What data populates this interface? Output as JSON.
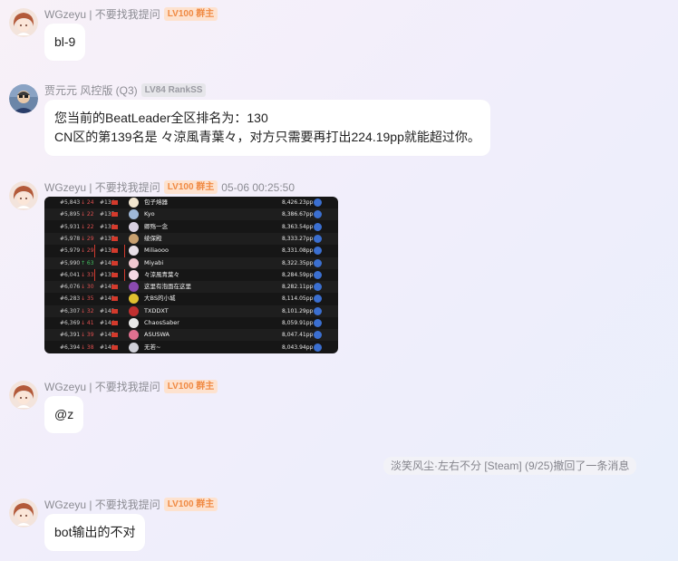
{
  "messages": [
    {
      "sender": "WGzeyu | 不要找我提问",
      "badge": "LV100 群主",
      "text": "bl-9"
    },
    {
      "sender": "贾元元 风控版 (Q3)",
      "badge": "LV84 RankSS",
      "line1": "您当前的BeatLeader全区排名为：130",
      "line2": "CN区的第139名是 々涼風青葉々，对方只需要再打出224.19pp就能超过你。"
    },
    {
      "sender": "WGzeyu | 不要找我提问",
      "badge": "LV100 群主",
      "time": "05-06 00:25:50",
      "leaderboard": [
        {
          "global": "#5,843",
          "delta": "↓ 24",
          "dir": "down",
          "country": "#134",
          "name": "包子熔器",
          "pp": "8,426.23pp",
          "color": "#f2e6d0"
        },
        {
          "global": "#5,895",
          "delta": "↓ 22",
          "dir": "down",
          "country": "#135",
          "name": "Kyo",
          "pp": "8,386.67pp",
          "color": "#9fb8d8"
        },
        {
          "global": "#5,931",
          "delta": "↓ 22",
          "dir": "down",
          "country": "#136",
          "name": "卿殇一念",
          "pp": "8,363.54pp",
          "color": "#d8d0e0"
        },
        {
          "global": "#5,978",
          "delta": "↓ 29",
          "dir": "down",
          "country": "#137",
          "name": "绫保殿",
          "pp": "8,333.27pp",
          "color": "#c8a070"
        },
        {
          "global": "#5,979",
          "delta": "↓ 29",
          "dir": "down",
          "country": "#138",
          "name": "Miliaooo",
          "pp": "8,331.08pp",
          "color": "#e8e0e8"
        },
        {
          "global": "#5,990",
          "delta": "↑ 63",
          "dir": "up",
          "country": "#140",
          "name": "Miyabi",
          "pp": "8,322.35pp",
          "color": "#f0c8d0"
        },
        {
          "global": "#6,041",
          "delta": "↓ 33",
          "dir": "down",
          "country": "#139",
          "name": "々涼風青葉々",
          "pp": "8,284.59pp",
          "color": "#f4d8e4"
        },
        {
          "global": "#6,076",
          "delta": "↓ 30",
          "dir": "down",
          "country": "#141",
          "name": "这里有泡面在这里",
          "pp": "8,282.11pp",
          "color": "#8a4ab0"
        },
        {
          "global": "#6,283",
          "delta": "↓ 35",
          "dir": "down",
          "country": "#142",
          "name": "大BS的小城",
          "pp": "8,114.05pp",
          "color": "#e0c030"
        },
        {
          "global": "#6,307",
          "delta": "↓ 32",
          "dir": "down",
          "country": "#143",
          "name": "TXDDXT",
          "pp": "8,101.29pp",
          "color": "#c03030"
        },
        {
          "global": "#6,369",
          "delta": "↓ 41",
          "dir": "down",
          "country": "#144",
          "name": "ChaosSaber",
          "pp": "8,059.91pp",
          "color": "#e8e8e8"
        },
        {
          "global": "#6,391",
          "delta": "↓ 39",
          "dir": "down",
          "country": "#145",
          "name": "ASUSWA",
          "pp": "8,047.41pp",
          "color": "#e07090"
        },
        {
          "global": "#6,394",
          "delta": "↓ 38",
          "dir": "down",
          "country": "#146",
          "name": "无若~",
          "pp": "8,043.94pp",
          "color": "#d0d0d8"
        }
      ]
    },
    {
      "sender": "WGzeyu | 不要找我提问",
      "badge": "LV100 群主",
      "text": "@z"
    },
    {
      "recall": "淡笑风尘·左右不分 [Steam] (9/25)撤回了一条消息"
    },
    {
      "sender": "WGzeyu | 不要找我提问",
      "badge": "LV100 群主",
      "text": "bot输出的不对"
    }
  ],
  "icons": {
    "anime_avatar": "anime-girl-avatar-icon",
    "photo_avatar": "person-photo-avatar-icon",
    "profile_button": "user-profile-icon"
  }
}
